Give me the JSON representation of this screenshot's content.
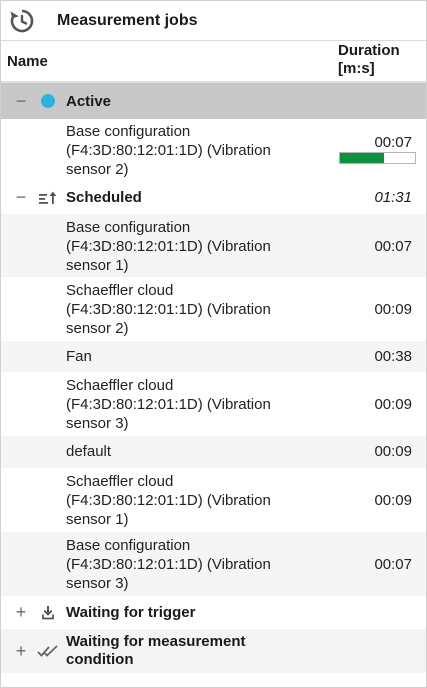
{
  "header": {
    "title": "Measurement jobs"
  },
  "columns": {
    "name": "Name",
    "duration": "Duration\n[m:s]"
  },
  "groups": {
    "active": {
      "label": "Active",
      "toggle": "−",
      "dot_color": "#2bb5de",
      "items": [
        {
          "label": "Base configuration\n(F4:3D:80:12:01:1D) (Vibration\nsensor 2)",
          "time": "00:07",
          "progress": 0.58
        }
      ]
    },
    "scheduled": {
      "label": "Scheduled",
      "toggle": "−",
      "total": "01:31",
      "items": [
        {
          "label": "Base configuration\n(F4:3D:80:12:01:1D) (Vibration\nsensor 1)",
          "time": "00:07"
        },
        {
          "label": "Schaeffler cloud\n(F4:3D:80:12:01:1D) (Vibration\nsensor 2)",
          "time": "00:09"
        },
        {
          "label": "Fan",
          "time": "00:38"
        },
        {
          "label": "Schaeffler cloud\n(F4:3D:80:12:01:1D) (Vibration\nsensor 3)",
          "time": "00:09"
        },
        {
          "label": "default",
          "time": "00:09"
        },
        {
          "label": "Schaeffler cloud\n(F4:3D:80:12:01:1D) (Vibration\nsensor 1)",
          "time": "00:09"
        },
        {
          "label": "Base configuration\n(F4:3D:80:12:01:1D) (Vibration\nsensor 3)",
          "time": "00:07"
        }
      ]
    },
    "waiting_trigger": {
      "label": "Waiting for trigger",
      "toggle": "+"
    },
    "waiting_condition": {
      "label": "Waiting for measurement\ncondition",
      "toggle": "+"
    }
  },
  "colors": {
    "progress_fill": "#0f9142",
    "active_bg": "#c8c8c8"
  }
}
